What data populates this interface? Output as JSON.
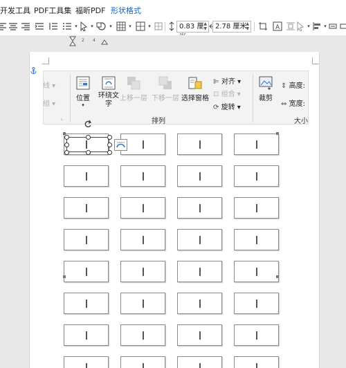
{
  "menu": {
    "items": [
      "开发工具",
      "PDF工具集",
      "福昕PDF",
      "形状格式"
    ],
    "active_index": 3
  },
  "toolbar": {
    "height_value": "0.83 厘米",
    "width_value": "2.78 厘米"
  },
  "ruler": {
    "marks": [
      "2",
      "4"
    ]
  },
  "ribbon": {
    "left_fragments": {
      "top": "线",
      "middle": "组"
    },
    "position": "位置",
    "wrap_text": "环绕文字",
    "bring_forward": "上移一层",
    "send_backward": "下移一层",
    "selection_pane": "选择窗格",
    "align": "对齐",
    "group": "组合",
    "rotate": "旋转",
    "crop": "裁剪",
    "height_label": "高度:",
    "width_label": "宽度:",
    "group_arrange": "排列",
    "group_size": "大小"
  },
  "label_grid": {
    "rows": 8,
    "columns": 4
  },
  "colors": {
    "accent": "#1a5fb4",
    "label_border": "#8a8a8a"
  }
}
